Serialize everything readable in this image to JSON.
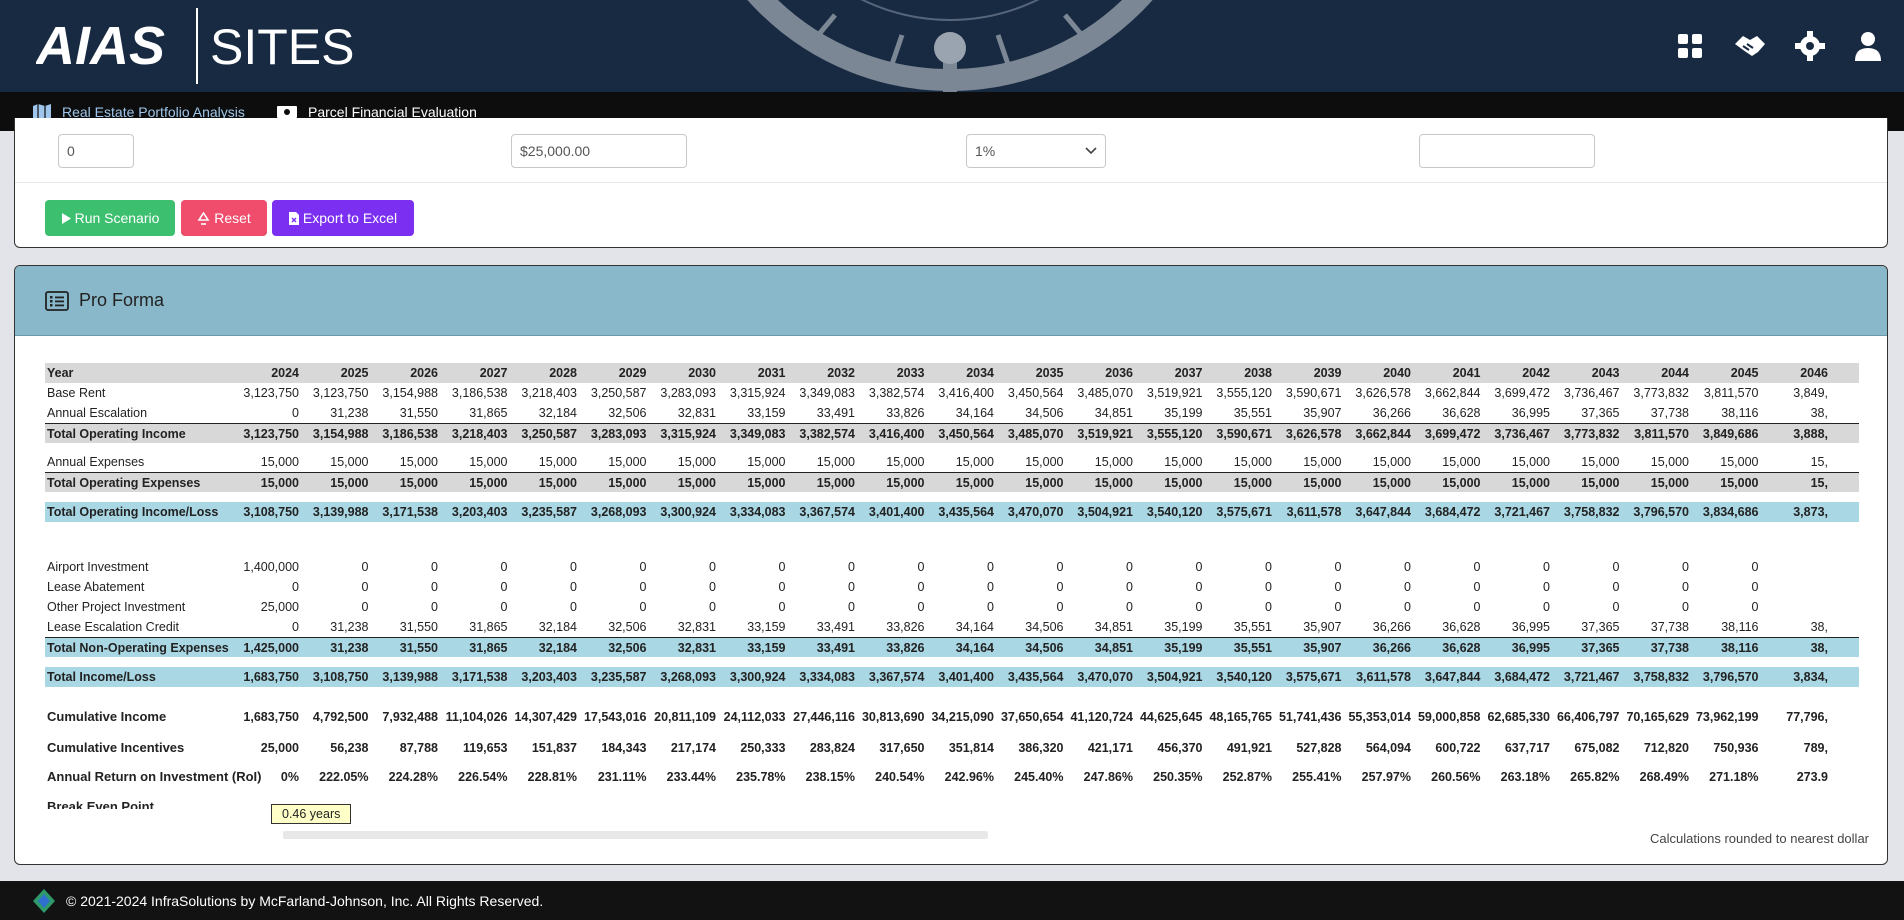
{
  "brand": {
    "left": "AIAS",
    "right": "SITES"
  },
  "nav": {
    "tabs": [
      {
        "label": "Real Estate Portfolio Analysis"
      },
      {
        "label": "Parcel Financial Evaluation"
      }
    ]
  },
  "form": {
    "field1_value": "0",
    "field2_value": "$25,000.00",
    "field3_value": "1%",
    "field4_value": ""
  },
  "buttons": {
    "run": "Run Scenario",
    "reset": "Reset",
    "export": "Export to Excel"
  },
  "proforma": {
    "title": "Pro Forma",
    "columns": [
      "2024",
      "2025",
      "2026",
      "2027",
      "2028",
      "2029",
      "2030",
      "2031",
      "2032",
      "2033",
      "2034",
      "2035",
      "2036",
      "2037",
      "2038",
      "2039",
      "2040",
      "2041",
      "2042",
      "2043",
      "2044",
      "2045",
      "2046"
    ],
    "rows": [
      {
        "label": "Year",
        "style": "header"
      },
      {
        "label": "Base Rent",
        "values": [
          "3,123,750",
          "3,123,750",
          "3,154,988",
          "3,186,538",
          "3,218,403",
          "3,250,587",
          "3,283,093",
          "3,315,924",
          "3,349,083",
          "3,382,574",
          "3,416,400",
          "3,450,564",
          "3,485,070",
          "3,519,921",
          "3,555,120",
          "3,590,671",
          "3,626,578",
          "3,662,844",
          "3,699,472",
          "3,736,467",
          "3,773,832",
          "3,811,570",
          "3,849,"
        ]
      },
      {
        "label": "Annual Escalation",
        "values": [
          "0",
          "31,238",
          "31,550",
          "31,865",
          "32,184",
          "32,506",
          "32,831",
          "33,159",
          "33,491",
          "33,826",
          "34,164",
          "34,506",
          "34,851",
          "35,199",
          "35,551",
          "35,907",
          "36,266",
          "36,628",
          "36,995",
          "37,365",
          "37,738",
          "38,116",
          "38,"
        ]
      },
      {
        "label": "Total Operating Income",
        "style": "total",
        "values": [
          "3,123,750",
          "3,154,988",
          "3,186,538",
          "3,218,403",
          "3,250,587",
          "3,283,093",
          "3,315,924",
          "3,349,083",
          "3,382,574",
          "3,416,400",
          "3,450,564",
          "3,485,070",
          "3,519,921",
          "3,555,120",
          "3,590,671",
          "3,626,578",
          "3,662,844",
          "3,699,472",
          "3,736,467",
          "3,773,832",
          "3,811,570",
          "3,849,686",
          "3,888,"
        ]
      },
      {
        "label": "Annual Expenses",
        "values": [
          "15,000",
          "15,000",
          "15,000",
          "15,000",
          "15,000",
          "15,000",
          "15,000",
          "15,000",
          "15,000",
          "15,000",
          "15,000",
          "15,000",
          "15,000",
          "15,000",
          "15,000",
          "15,000",
          "15,000",
          "15,000",
          "15,000",
          "15,000",
          "15,000",
          "15,000",
          "15,"
        ]
      },
      {
        "label": "Total Operating Expenses",
        "style": "total",
        "values": [
          "15,000",
          "15,000",
          "15,000",
          "15,000",
          "15,000",
          "15,000",
          "15,000",
          "15,000",
          "15,000",
          "15,000",
          "15,000",
          "15,000",
          "15,000",
          "15,000",
          "15,000",
          "15,000",
          "15,000",
          "15,000",
          "15,000",
          "15,000",
          "15,000",
          "15,000",
          "15,"
        ]
      },
      {
        "label": "Total Operating Income/Loss",
        "style": "blue",
        "values": [
          "3,108,750",
          "3,139,988",
          "3,171,538",
          "3,203,403",
          "3,235,587",
          "3,268,093",
          "3,300,924",
          "3,334,083",
          "3,367,574",
          "3,401,400",
          "3,435,564",
          "3,470,070",
          "3,504,921",
          "3,540,120",
          "3,575,671",
          "3,611,578",
          "3,647,844",
          "3,684,472",
          "3,721,467",
          "3,758,832",
          "3,796,570",
          "3,834,686",
          "3,873,"
        ]
      },
      {
        "label": "Airport Investment",
        "values": [
          "1,400,000",
          "0",
          "0",
          "0",
          "0",
          "0",
          "0",
          "0",
          "0",
          "0",
          "0",
          "0",
          "0",
          "0",
          "0",
          "0",
          "0",
          "0",
          "0",
          "0",
          "0",
          "0",
          ""
        ]
      },
      {
        "label": "Lease Abatement",
        "values": [
          "0",
          "0",
          "0",
          "0",
          "0",
          "0",
          "0",
          "0",
          "0",
          "0",
          "0",
          "0",
          "0",
          "0",
          "0",
          "0",
          "0",
          "0",
          "0",
          "0",
          "0",
          "0",
          ""
        ]
      },
      {
        "label": "Other Project Investment",
        "values": [
          "25,000",
          "0",
          "0",
          "0",
          "0",
          "0",
          "0",
          "0",
          "0",
          "0",
          "0",
          "0",
          "0",
          "0",
          "0",
          "0",
          "0",
          "0",
          "0",
          "0",
          "0",
          "0",
          ""
        ]
      },
      {
        "label": "Lease Escalation Credit",
        "values": [
          "0",
          "31,238",
          "31,550",
          "31,865",
          "32,184",
          "32,506",
          "32,831",
          "33,159",
          "33,491",
          "33,826",
          "34,164",
          "34,506",
          "34,851",
          "35,199",
          "35,551",
          "35,907",
          "36,266",
          "36,628",
          "36,995",
          "37,365",
          "37,738",
          "38,116",
          "38,"
        ]
      },
      {
        "label": "Total Non-Operating Expenses",
        "style": "bluetotal",
        "values": [
          "1,425,000",
          "31,238",
          "31,550",
          "31,865",
          "32,184",
          "32,506",
          "32,831",
          "33,159",
          "33,491",
          "33,826",
          "34,164",
          "34,506",
          "34,851",
          "35,199",
          "35,551",
          "35,907",
          "36,266",
          "36,628",
          "36,995",
          "37,365",
          "37,738",
          "38,116",
          "38,"
        ]
      },
      {
        "label": "Total Income/Loss",
        "style": "blue",
        "values": [
          "1,683,750",
          "3,108,750",
          "3,139,988",
          "3,171,538",
          "3,203,403",
          "3,235,587",
          "3,268,093",
          "3,300,924",
          "3,334,083",
          "3,367,574",
          "3,401,400",
          "3,435,564",
          "3,470,070",
          "3,504,921",
          "3,540,120",
          "3,575,671",
          "3,611,578",
          "3,647,844",
          "3,684,472",
          "3,721,467",
          "3,758,832",
          "3,796,570",
          "3,834,"
        ]
      },
      {
        "label": "Cumulative Income",
        "style": "bold",
        "values": [
          "1,683,750",
          "4,792,500",
          "7,932,488",
          "11,104,026",
          "14,307,429",
          "17,543,016",
          "20,811,109",
          "24,112,033",
          "27,446,116",
          "30,813,690",
          "34,215,090",
          "37,650,654",
          "41,120,724",
          "44,625,645",
          "48,165,765",
          "51,741,436",
          "55,353,014",
          "59,000,858",
          "62,685,330",
          "66,406,797",
          "70,165,629",
          "73,962,199",
          "77,796,"
        ]
      },
      {
        "label": "Cumulative Incentives",
        "style": "bold",
        "values": [
          "25,000",
          "56,238",
          "87,788",
          "119,653",
          "151,837",
          "184,343",
          "217,174",
          "250,333",
          "283,824",
          "317,650",
          "351,814",
          "386,320",
          "421,171",
          "456,370",
          "491,921",
          "527,828",
          "564,094",
          "600,722",
          "637,717",
          "675,082",
          "712,820",
          "750,936",
          "789,"
        ]
      },
      {
        "label": "Annual Return on Investment (RoI)",
        "style": "bold",
        "values": [
          "0%",
          "222.05%",
          "224.28%",
          "226.54%",
          "228.81%",
          "231.11%",
          "233.44%",
          "235.78%",
          "238.15%",
          "240.54%",
          "242.96%",
          "245.40%",
          "247.86%",
          "250.35%",
          "252.87%",
          "255.41%",
          "257.97%",
          "260.56%",
          "263.18%",
          "265.82%",
          "268.49%",
          "271.18%",
          "273.9"
        ]
      },
      {
        "label": "Break Even Point",
        "style": "bold"
      }
    ],
    "break_even_value": "0.46 years",
    "footnote": "Calculations rounded to nearest dollar"
  },
  "footer": {
    "text": "© 2021-2024 InfraSolutions by McFarland-Johnson, Inc. All Rights Reserved."
  }
}
